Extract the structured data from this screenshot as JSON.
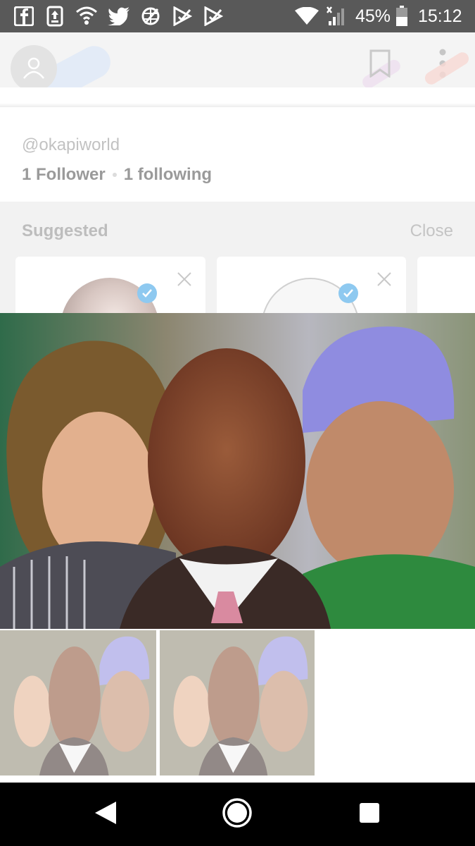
{
  "status_bar": {
    "battery": "45%",
    "time": "15:12",
    "left_icons": [
      "facebook-icon",
      "download-icon",
      "shield-wifi-icon",
      "twitter-icon",
      "vpn-icon",
      "play-check-icon",
      "play-check-icon"
    ],
    "right_icons": [
      "wifi-icon",
      "signal-icon",
      "battery-icon"
    ]
  },
  "header": {
    "icons": [
      "avatar-icon",
      "bookmark-icon",
      "more-vert-icon"
    ]
  },
  "profile": {
    "username": "@okapiworld",
    "followers": "1 Follower",
    "following": "1 following"
  },
  "suggested": {
    "title": "Suggested",
    "close_label": "Close"
  },
  "nav": {
    "icons": [
      "back-icon",
      "home-icon",
      "recents-icon"
    ]
  },
  "colors": {
    "status_bar": "#595959",
    "header_bg": "#f4f4f4",
    "verified": "#8ec9f0",
    "nav_bar": "#000000"
  }
}
